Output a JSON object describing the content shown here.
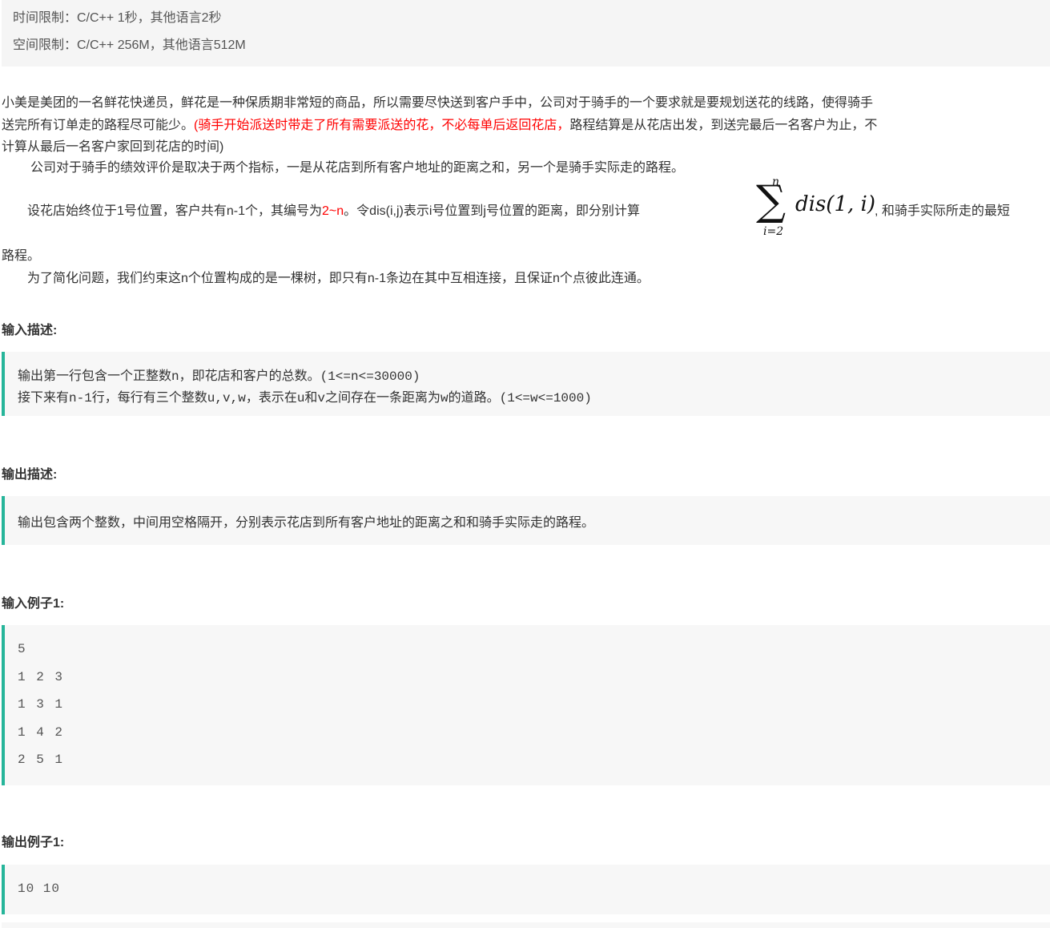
{
  "limits": {
    "time": "时间限制：C/C++ 1秒，其他语言2秒",
    "space": "空间限制：C/C++ 256M，其他语言512M"
  },
  "description": {
    "p1_part1": "小美是美团的一名鲜花快递员，鲜花是一种保质期非常短的商品，所以需要尽快送到客户手中，公司对于骑手的一个要求就是要规划送花的线路，使得骑手",
    "p1_part2a": "送完所有订单走的路程尽可能少。",
    "p1_red": "(骑手开始派送时带走了所有需要派送的花，不必每单后返回花店，",
    "p1_part2b": "路程结算是从花店出发，到送完最后一名客户为止，不",
    "p1_part3": "计算从最后一名客户家回到花店的时间)",
    "p2": "公司对于骑手的绩效评价是取决于两个指标，一是从花店到所有客户地址的距离之和，另一个是骑手实际走的路程。",
    "p3_a": "设花店始终位于1号位置，客户共有n-1个，其编号为",
    "p3_red": "2~n",
    "p3_b": "。令dis(i,j)表示i号位置到j号位置的距离，即分别计算",
    "p3_c": ", 和骑手实际所走的最短",
    "p3_d": "路程。",
    "p4": "为了简化问题，我们约束这n个位置构成的是一棵树，即只有n-1条边在其中互相连接，且保证n个点彼此连通。",
    "math_top": "n",
    "math_sum": "∑",
    "math_bottom": "i=2",
    "math_expr": "dis(1, i)"
  },
  "input_desc": {
    "heading": "输入描述:",
    "line1": "输出第一行包含一个正整数n，即花店和客户的总数。(1<=n<=30000)",
    "line2": "接下来有n-1行，每行有三个整数u,v,w，表示在u和v之间存在一条距离为w的道路。(1<=w<=1000)"
  },
  "output_desc": {
    "heading": "输出描述:",
    "line1": "输出包含两个整数，中间用空格隔开，分别表示花店到所有客户地址的距离之和和骑手实际走的路程。"
  },
  "example_input": {
    "heading": "输入例子1:",
    "lines": [
      "5",
      "1 2 3",
      "1 3 1",
      "1 4 2",
      "2 5 1"
    ]
  },
  "example_output": {
    "heading": "输出例子1:",
    "line": "10 10"
  },
  "colors": {
    "accent_border": "#26b59a",
    "highlight_red": "#ff0000",
    "box_bg": "#f7f7f7"
  }
}
